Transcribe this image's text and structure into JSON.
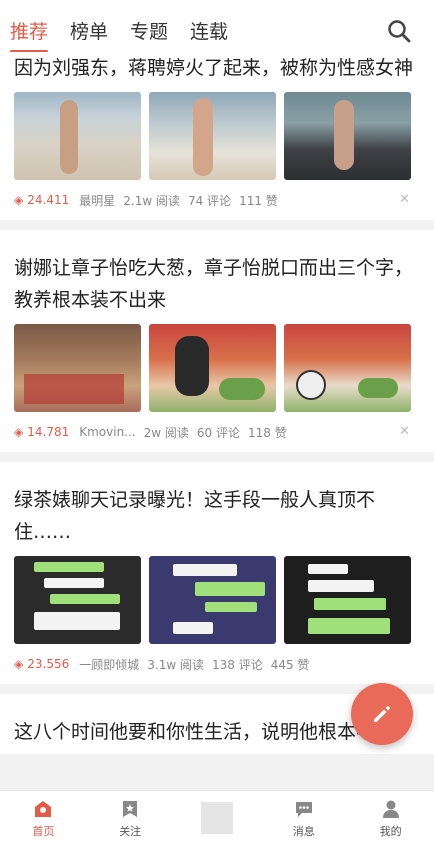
{
  "tabs": [
    "推荐",
    "榜单",
    "专题",
    "连载"
  ],
  "icons": {
    "search": "search-icon",
    "compose": "pencil-icon",
    "diamond": "diamond-icon",
    "close": "close-icon"
  },
  "colors": {
    "accent": "#e45b4a",
    "fab": "#e96a58"
  },
  "articles": [
    {
      "title": "因为刘强东，蒋聘婷火了起来，被称为性感女神",
      "score": "24.411",
      "author": "最明星",
      "reads": "2.1w 阅读",
      "comments": "74 评论",
      "likes": "111 赞"
    },
    {
      "title": "谢娜让章子怡吃大葱，章子怡脱口而出三个字，教养根本装不出来",
      "score": "14.781",
      "author": "Kmovin...",
      "reads": "2w 阅读",
      "comments": "60 评论",
      "likes": "118 赞"
    },
    {
      "title": "绿茶婊聊天记录曝光！这手段一般人真顶不住……",
      "score": "23.556",
      "author": "一顾即倾城",
      "reads": "3.1w 阅读",
      "comments": "138 评论",
      "likes": "445 赞"
    },
    {
      "title": "这八个时间他要和你性生活，说明他根本不爱"
    }
  ],
  "bottom_nav": [
    "首页",
    "关注",
    "",
    "消息",
    "我的"
  ]
}
